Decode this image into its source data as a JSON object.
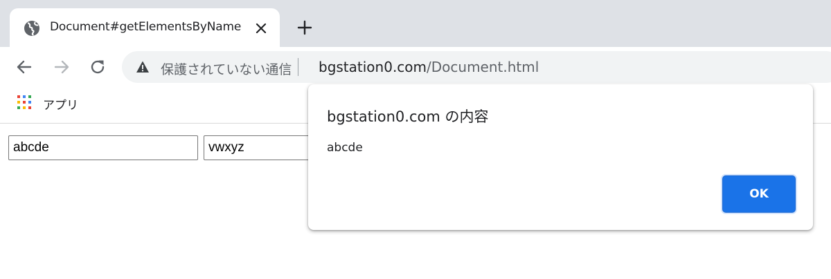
{
  "browser": {
    "tab": {
      "title": "Document#getElementsByName",
      "favicon": "globe-icon",
      "close_icon": "close-icon"
    },
    "new_tab_icon": "plus-icon",
    "nav": {
      "back_icon": "arrow-left-icon",
      "forward_icon": "arrow-right-icon",
      "reload_icon": "reload-icon"
    },
    "omnibox": {
      "security_icon": "warning-icon",
      "security_text": "保護されていない通信",
      "url_host": "bgstation0.com",
      "url_path": "/Document.html"
    },
    "bookmarks": {
      "apps_icon": "apps-grid-icon",
      "apps_label": "アプリ"
    }
  },
  "page": {
    "inputs": [
      {
        "value": "abcde"
      },
      {
        "value": "vwxyz"
      }
    ]
  },
  "dialog": {
    "title": "bgstation0.com の内容",
    "message": "abcde",
    "ok_label": "OK"
  },
  "colors": {
    "tabstrip": "#dee1e6",
    "omnibox": "#f1f3f4",
    "accent": "#1a73e8",
    "text": "#202124",
    "muted": "#5f6368"
  }
}
